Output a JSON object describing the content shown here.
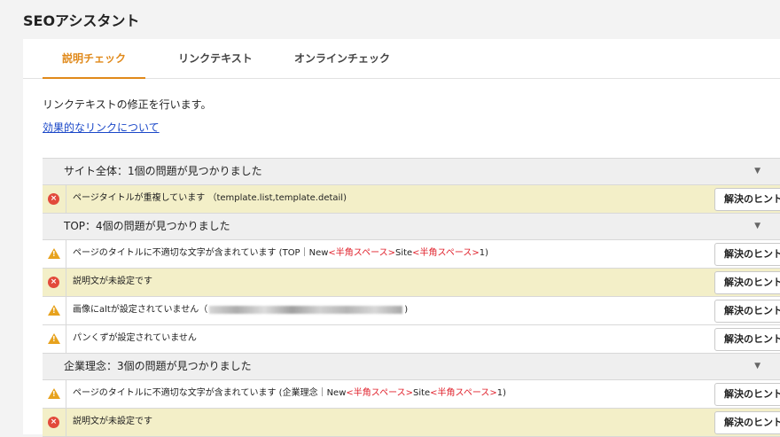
{
  "app_title": "SEOアシスタント",
  "tabs": [
    {
      "label": "説明チェック",
      "active": true
    },
    {
      "label": "リンクテキスト",
      "active": false
    },
    {
      "label": "オンラインチェック",
      "active": false
    }
  ],
  "description": "リンクテキストの修正を行います。",
  "help_link": "効果的なリンクについて",
  "hint_label": "解決のヒント",
  "groups": [
    {
      "header": "サイト全体：1個の問題が見つかりました",
      "issues": [
        {
          "severity": "error",
          "text": "ページタイトルが重複しています （template.list,template.detail)"
        }
      ]
    },
    {
      "header": "TOP：4個の問題が見つかりました",
      "issues": [
        {
          "severity": "warning",
          "text_parts": [
            "ページのタイトルに不適切な文字が含まれています (TOP｜New",
            "<半角スペース>",
            "Site",
            "<半角スペース>",
            "1)"
          ]
        },
        {
          "severity": "error",
          "text": "説明文が未設定です"
        },
        {
          "severity": "warning",
          "text_parts": [
            "画像にaltが設定されていません（",
            ")"
          ]
        },
        {
          "severity": "warning",
          "text": "パンくずが設定されていません"
        }
      ]
    },
    {
      "header": "企業理念：3個の問題が見つかりました",
      "issues": [
        {
          "severity": "warning",
          "text_parts": [
            "ページのタイトルに不適切な文字が含まれています (企業理念｜New",
            "<半角スペース>",
            "Site",
            "<半角スペース>",
            "1)"
          ]
        },
        {
          "severity": "error",
          "text": "説明文が未設定です"
        }
      ]
    }
  ],
  "colors": {
    "accent": "#e0891a",
    "error": "#e24a3b",
    "warning": "#e7a21d",
    "error_row_bg": "#f3efc8",
    "link": "#1a47c8",
    "highlight_text": "#e0202b"
  }
}
